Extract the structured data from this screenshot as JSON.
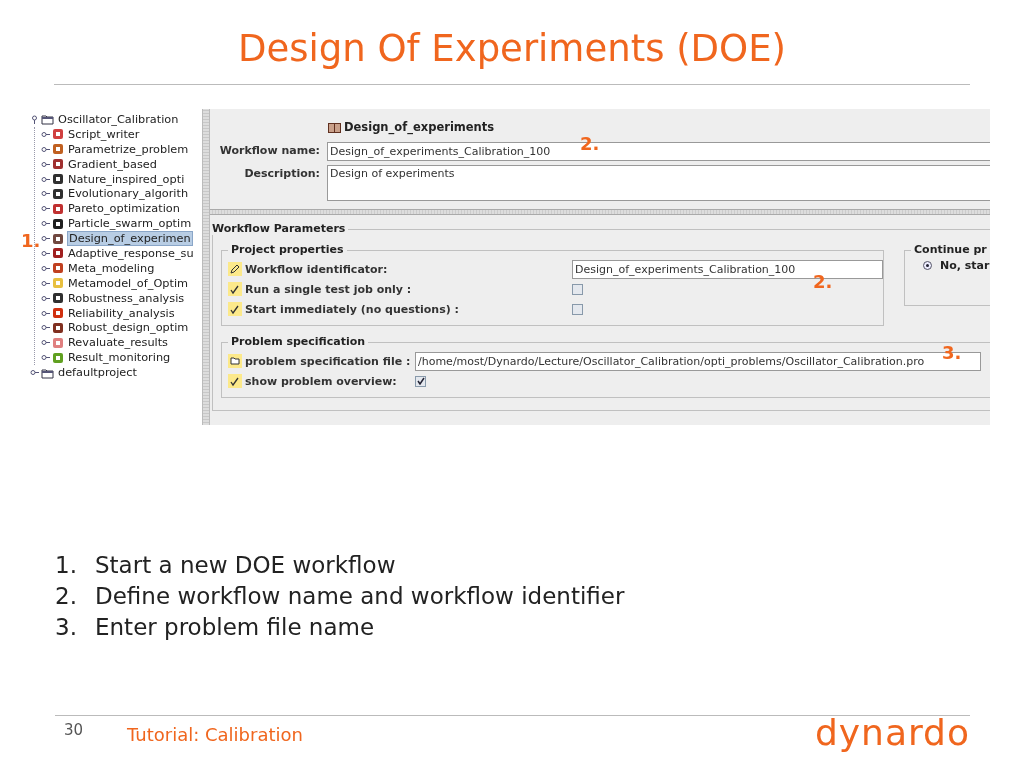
{
  "slide": {
    "title": "Design Of Experiments (DOE)",
    "page_number": "30",
    "footer": "Tutorial: Calibration",
    "logo": "dynardo"
  },
  "app": {
    "tree": [
      {
        "label": "Oscillator_Calibration",
        "expanded": true,
        "selected": false,
        "children": [
          {
            "label": "Script_writer",
            "color": "#d04040",
            "selected": false
          },
          {
            "label": "Parametrize_problem",
            "color": "#c06020",
            "selected": false
          },
          {
            "label": "Gradient_based",
            "color": "#a03030",
            "selected": false
          },
          {
            "label": "Nature_inspired_opti",
            "color": "#303030",
            "selected": false
          },
          {
            "label": "Evolutionary_algorith",
            "color": "#303030",
            "selected": false
          },
          {
            "label": "Pareto_optimization",
            "color": "#c03030",
            "selected": false
          },
          {
            "label": "Particle_swarm_optim",
            "color": "#202020",
            "selected": false
          },
          {
            "label": "Design_of_experimen",
            "color": "#704840",
            "selected": true
          },
          {
            "label": "Adaptive_response_su",
            "color": "#a02020",
            "selected": false
          },
          {
            "label": "Meta_modeling",
            "color": "#c04020",
            "selected": false
          },
          {
            "label": "Metamodel_of_Optim",
            "color": "#e8c040",
            "selected": false
          },
          {
            "label": "Robustness_analysis",
            "color": "#303030",
            "selected": false
          },
          {
            "label": "Reliability_analysis",
            "color": "#d03010",
            "selected": false
          },
          {
            "label": "Robust_design_optim",
            "color": "#803020",
            "selected": false
          },
          {
            "label": "Revaluate_results",
            "color": "#e08080",
            "selected": false
          },
          {
            "label": "Result_monitoring",
            "color": "#60a020",
            "selected": false
          }
        ]
      },
      {
        "label": "defaultproject",
        "expanded": false,
        "selected": false
      }
    ],
    "header": "Design_of_experiments",
    "workflow_name": {
      "label": "Workflow name:",
      "value": "Design_of_experiments_Calibration_100"
    },
    "description": {
      "label": "Description:",
      "value": "Design of experiments"
    },
    "workflow_parameters": {
      "title": "Workflow Parameters",
      "project_properties": {
        "title": "Project properties",
        "rows": [
          {
            "kind": "text",
            "label": "Workflow identificator:",
            "value": "Design_of_experiments_Calibration_100"
          },
          {
            "kind": "checkbox",
            "label": "Run a single test job only :",
            "checked": false
          },
          {
            "kind": "checkbox",
            "label": "Start immediately (no questions) :",
            "checked": false
          }
        ]
      },
      "continue": {
        "title": "Continue pr",
        "options": [
          {
            "label": "No, star",
            "selected": true
          }
        ]
      },
      "problem_specification": {
        "title": "Problem specification",
        "rows": [
          {
            "kind": "file",
            "label": "problem specification file :",
            "value": "/home/most/Dynardo/Lecture/Oscillator_Calibration/opti_problems/Oscillator_Calibration.pro"
          },
          {
            "kind": "checkbox",
            "label": "show problem overview:",
            "checked": true
          }
        ]
      }
    }
  },
  "callouts": [
    "1.",
    "2.",
    "2.",
    "3."
  ],
  "steps": [
    {
      "number": "1.",
      "text": "Start a new DOE workflow"
    },
    {
      "number": "2.",
      "text": "Define workflow name and workflow identifier"
    },
    {
      "number": "3.",
      "text": "Enter problem file name"
    }
  ]
}
